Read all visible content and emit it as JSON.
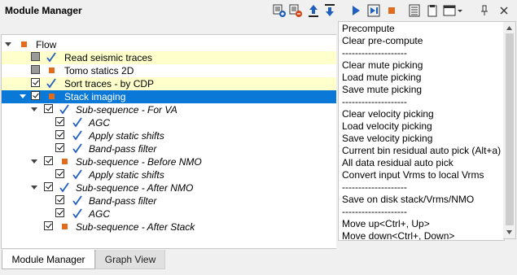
{
  "window": {
    "title": "Module Manager"
  },
  "toolbar": {
    "icons": [
      "add-module-icon",
      "remove-module-icon",
      "move-up-icon",
      "move-down-icon",
      "run-icon",
      "run-step-icon",
      "stop-icon",
      "list-icon",
      "clipboard-icon",
      "window-menu-icon",
      "pin-icon",
      "close-icon"
    ]
  },
  "tree": {
    "root": {
      "label": "Flow"
    },
    "items": [
      {
        "label": "Read seismic traces"
      },
      {
        "label": "Tomo statics 2D"
      },
      {
        "label": "Sort traces - by CDP"
      },
      {
        "label": "Stack imaging"
      },
      {
        "label": "Sub-sequence - For VA"
      },
      {
        "label": "AGC"
      },
      {
        "label": "Apply static shifts"
      },
      {
        "label": "Band-pass filter"
      },
      {
        "label": "Sub-sequence - Before NMO"
      },
      {
        "label": "Apply static shifts"
      },
      {
        "label": "Sub-sequence - After NMO"
      },
      {
        "label": "Band-pass filter"
      },
      {
        "label": "AGC"
      },
      {
        "label": "Sub-sequence - After Stack"
      }
    ]
  },
  "context_menu": {
    "items": [
      "Precompute",
      "Clear pre-compute",
      "--------------------",
      "Clear mute picking",
      "Load mute picking",
      "Save mute picking",
      "--------------------",
      "Clear velocity picking",
      "Load velocity picking",
      "Save velocity picking",
      "Current bin residual auto pick (Alt+a)",
      "All data residual auto pick",
      "Convert input Vrms to local Vrms",
      "--------------------",
      "Save on disk stack/Vrms/NMO",
      "--------------------",
      "Move up<Ctrl+, Up>",
      "Move down<Ctrl+, Down>"
    ]
  },
  "tabs": [
    {
      "label": "Module Manager",
      "active": true
    },
    {
      "label": "Graph View",
      "active": false
    }
  ],
  "colors": {
    "selection": "#0a78d7",
    "highlight": "#ffffcc",
    "module_square": "#e36b1e",
    "check_blue": "#1f5fbf"
  }
}
